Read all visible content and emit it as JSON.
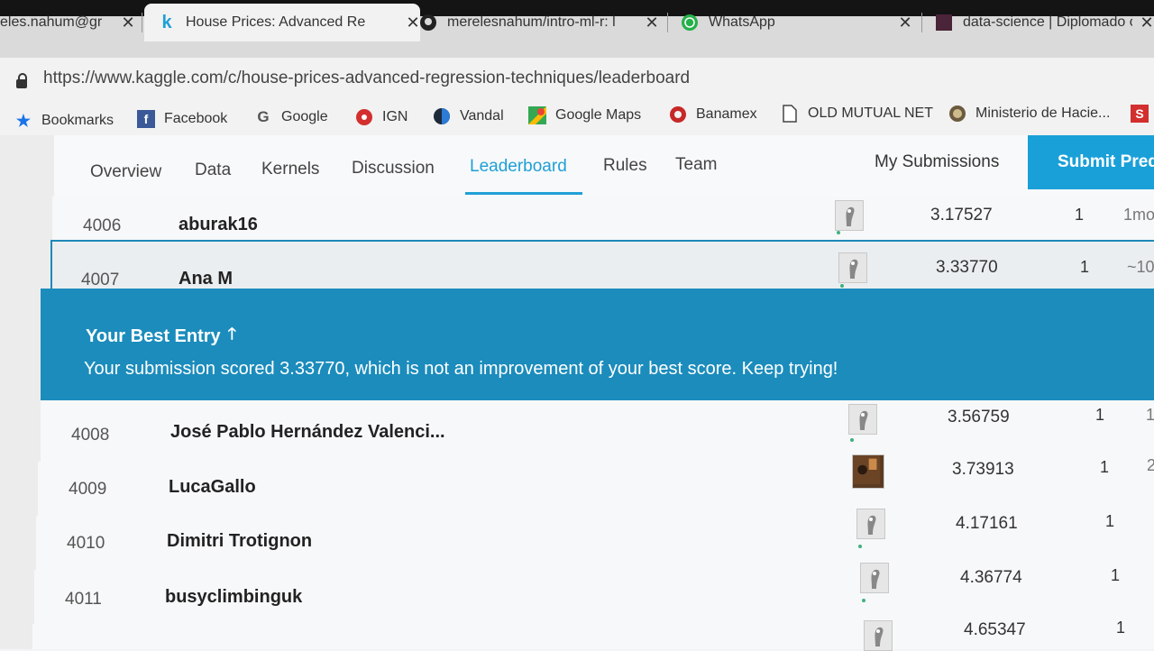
{
  "browser": {
    "tabs": [
      {
        "label": "eles.nahum@gr",
        "icon": "mail-icon"
      },
      {
        "label": "House Prices: Advanced Re",
        "icon": "kaggle-icon"
      },
      {
        "label": "merelesnahum/intro-ml-r: l",
        "icon": "github-icon"
      },
      {
        "label": "WhatsApp",
        "icon": "whatsapp-icon"
      },
      {
        "label": "data-science | Diplomado c",
        "icon": "site-icon"
      }
    ],
    "close_glyph": "✕",
    "url": "https://www.kaggle.com/c/house-prices-advanced-regression-techniques/leaderboard",
    "bookmarks": [
      {
        "label": "Bookmarks",
        "icon": "star-icon"
      },
      {
        "label": "Facebook",
        "icon": "facebook-icon"
      },
      {
        "label": "Google",
        "icon": "google-icon"
      },
      {
        "label": "IGN",
        "icon": "ign-icon"
      },
      {
        "label": "Vandal",
        "icon": "vandal-icon"
      },
      {
        "label": "Google Maps",
        "icon": "maps-icon"
      },
      {
        "label": "Banamex",
        "icon": "banamex-icon"
      },
      {
        "label": "OLD MUTUAL NET",
        "icon": "page-icon"
      },
      {
        "label": "Ministerio de Hacie...",
        "icon": "ministry-icon"
      }
    ]
  },
  "nav": {
    "tabs": [
      "Overview",
      "Data",
      "Kernels",
      "Discussion",
      "Leaderboard",
      "Rules",
      "Team"
    ],
    "active": "Leaderboard",
    "my_submissions": "My Submissions",
    "submit": "Submit Predictions"
  },
  "leaderboard": {
    "rows": [
      {
        "rank": "4006",
        "team": "aburak16",
        "score": "3.17527",
        "entries": "1",
        "last": "1mo"
      },
      {
        "rank": "4007",
        "team": "Ana M",
        "score": "3.33770",
        "entries": "1",
        "last": "~10"
      },
      {
        "rank": "4008",
        "team": "José Pablo Hernández Valenci...",
        "score": "3.56759",
        "entries": "1",
        "last": "1"
      },
      {
        "rank": "4009",
        "team": "LucaGallo",
        "score": "3.73913",
        "entries": "1",
        "last": "2"
      },
      {
        "rank": "4010",
        "team": "Dimitri Trotignon",
        "score": "4.17161",
        "entries": "1",
        "last": ""
      },
      {
        "rank": "4011",
        "team": "busyclimbinguk",
        "score": "4.36774",
        "entries": "1",
        "last": ""
      },
      {
        "rank": "",
        "team": "",
        "score": "4.65347",
        "entries": "1",
        "last": ""
      }
    ],
    "best_entry": {
      "title": "Your Best Entry",
      "arrow": "🡑",
      "message": "Your submission scored 3.33770, which is not an improvement of your best score. Keep trying!"
    }
  },
  "colors": {
    "accent": "#20a0d6",
    "banner": "#1b8cbc"
  }
}
